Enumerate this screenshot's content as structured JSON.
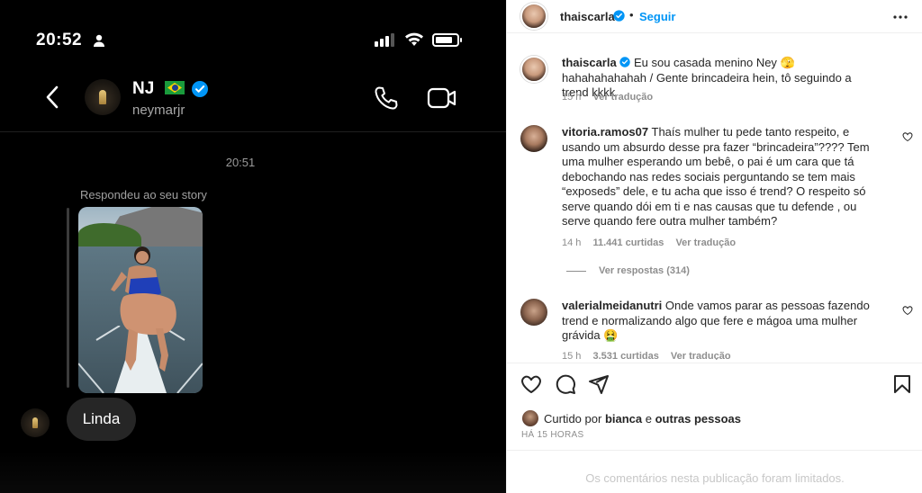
{
  "phone": {
    "time": "20:52",
    "chat_name": "NJ",
    "chat_handle": "neymarjr",
    "message_time": "20:51",
    "replied_label": "Respondeu ao seu story",
    "message": "Linda"
  },
  "post": {
    "username": "thaiscarla",
    "dot": "•",
    "follow_label": "Seguir",
    "caption": {
      "username": "thaiscarla",
      "text": "Eu sou casada menino Ney 🫣 hahahahahahah / Gente brincadeira hein, tô seguindo a trend kkkk",
      "time": "15 h",
      "translate": "Ver tradução"
    },
    "comments": [
      {
        "username": "vitoria.ramos07",
        "text": "Thaís mulher tu pede tanto respeito, e usando um absurdo desse pra fazer “brincadeira”???? Tem uma mulher esperando um bebê, o pai é um cara que tá debochando nas redes sociais perguntando se tem mais “exposeds” dele, e tu acha que isso é trend? O respeito só serve quando dói em ti e nas causas que tu defende , ou serve quando fere outra mulher também?",
        "time": "14 h",
        "likes": "11.441 curtidas",
        "translate": "Ver tradução",
        "replies": "Ver respostas (314)"
      },
      {
        "username": "valerialmeidanutri",
        "text": "Onde vamos parar as pessoas fazendo trend e normalizando algo que fere e mágoa uma mulher grávida 🤮",
        "time": "15 h",
        "likes": "3.531 curtidas",
        "translate": "Ver tradução"
      }
    ],
    "liked_by_prefix": "Curtido por",
    "liked_by_user": "bianca",
    "liked_by_join": "e",
    "liked_by_others": "outras pessoas",
    "timestamp": "HÁ 15 HORAS",
    "comments_limited": "Os comentários nesta publicação foram limitados."
  },
  "colors": {
    "link_blue": "#0095f6",
    "verified_blue": "#0095f6",
    "muted_gray": "#8e8e8e"
  },
  "icons": [
    "person-icon",
    "signal-icon",
    "wifi-icon",
    "battery-icon",
    "back-icon",
    "verified-icon",
    "call-icon",
    "video-icon",
    "more-icon",
    "heart-icon",
    "comment-icon",
    "share-icon",
    "bookmark-icon"
  ]
}
